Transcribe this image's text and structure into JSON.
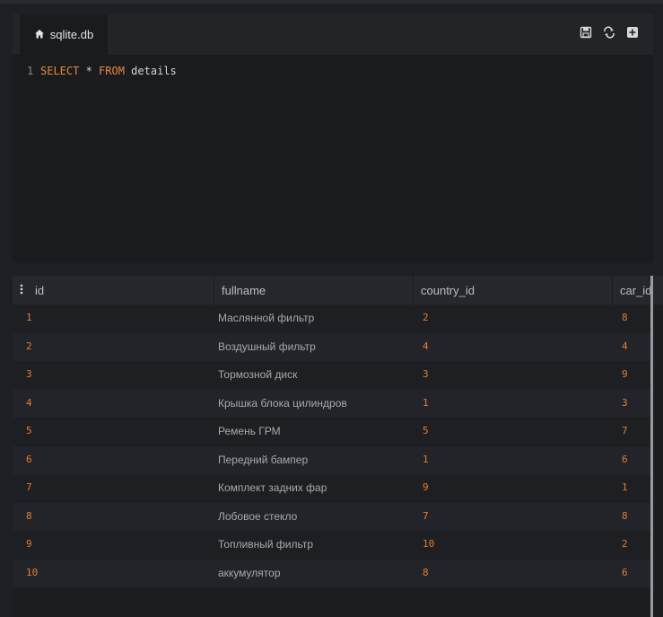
{
  "editor": {
    "tab_label": "sqlite.db",
    "toolbar_icons": [
      "save-icon",
      "refresh-icon",
      "add-tab-icon"
    ],
    "lines": [
      {
        "number": "1",
        "kw1": "SELECT",
        "mid": " * ",
        "kw2": "FROM",
        "rest": " details"
      }
    ]
  },
  "results": {
    "columns": [
      "id",
      "fullname",
      "country_id",
      "car_id"
    ],
    "rows": [
      [
        "1",
        "Маслянной фильтр",
        "2",
        "8"
      ],
      [
        "2",
        "Воздушный фильтр",
        "4",
        "4"
      ],
      [
        "3",
        "Тормозной диск",
        "3",
        "9"
      ],
      [
        "4",
        "Крышка блока цилиндров",
        "1",
        "3"
      ],
      [
        "5",
        "Ремень ГРМ",
        "5",
        "7"
      ],
      [
        "6",
        "Передний бампер",
        "1",
        "6"
      ],
      [
        "7",
        "Комплект задних фар",
        "9",
        "1"
      ],
      [
        "8",
        "Лобовое стекло",
        "7",
        "8"
      ],
      [
        "9",
        "Топливный фильтр",
        "10",
        "2"
      ],
      [
        "10",
        "аккумулятор",
        "8",
        "6"
      ]
    ]
  },
  "colors": {
    "keyword": "#e58a3a",
    "number": "#e37d2f",
    "background": "#1e1f24"
  }
}
